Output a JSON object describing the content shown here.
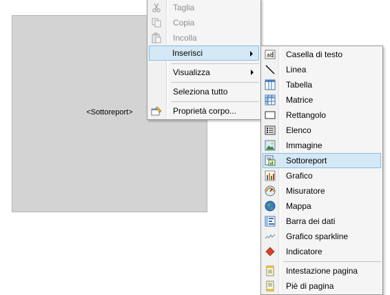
{
  "subreport": {
    "placeholder": "<Sottoreport>"
  },
  "context_menu": {
    "items": [
      {
        "label": "Taglia",
        "icon": "scissors-icon",
        "enabled": false
      },
      {
        "label": "Copia",
        "icon": "copy-icon",
        "enabled": false
      },
      {
        "label": "Incolla",
        "icon": "paste-icon",
        "enabled": false
      },
      {
        "label": "Inserisci",
        "icon": "",
        "enabled": true,
        "submenu": true,
        "highlighted": true
      },
      {
        "label": "Visualizza",
        "icon": "",
        "enabled": true,
        "submenu": true
      },
      {
        "label": "Seleziona tutto",
        "icon": "",
        "enabled": true
      },
      {
        "label": "Proprietà corpo...",
        "icon": "properties-icon",
        "enabled": true
      }
    ]
  },
  "insert_submenu": {
    "items": [
      {
        "label": "Casella di testo",
        "icon": "textbox-icon"
      },
      {
        "label": "Linea",
        "icon": "line-icon"
      },
      {
        "label": "Tabella",
        "icon": "table-icon"
      },
      {
        "label": "Matrice",
        "icon": "matrix-icon"
      },
      {
        "label": "Rettangolo",
        "icon": "rectangle-icon"
      },
      {
        "label": "Elenco",
        "icon": "list-icon"
      },
      {
        "label": "Immagine",
        "icon": "image-icon"
      },
      {
        "label": "Sottoreport",
        "icon": "subreport-icon",
        "highlighted": true
      },
      {
        "label": "Grafico",
        "icon": "chart-icon"
      },
      {
        "label": "Misuratore",
        "icon": "gauge-icon"
      },
      {
        "label": "Mappa",
        "icon": "map-icon"
      },
      {
        "label": "Barra dei dati",
        "icon": "databar-icon"
      },
      {
        "label": "Grafico sparkline",
        "icon": "sparkline-icon"
      },
      {
        "label": "Indicatore",
        "icon": "indicator-icon"
      },
      {
        "label": "Intestazione pagina",
        "icon": "page-header-icon"
      },
      {
        "label": "Piè di pagina",
        "icon": "page-footer-icon"
      }
    ]
  },
  "colors": {
    "highlight_bg": "#d5e8f5",
    "highlight_border": "#84bde5",
    "disabled_text": "#8d8d8d",
    "canvas_item": "#d3d3d3"
  }
}
